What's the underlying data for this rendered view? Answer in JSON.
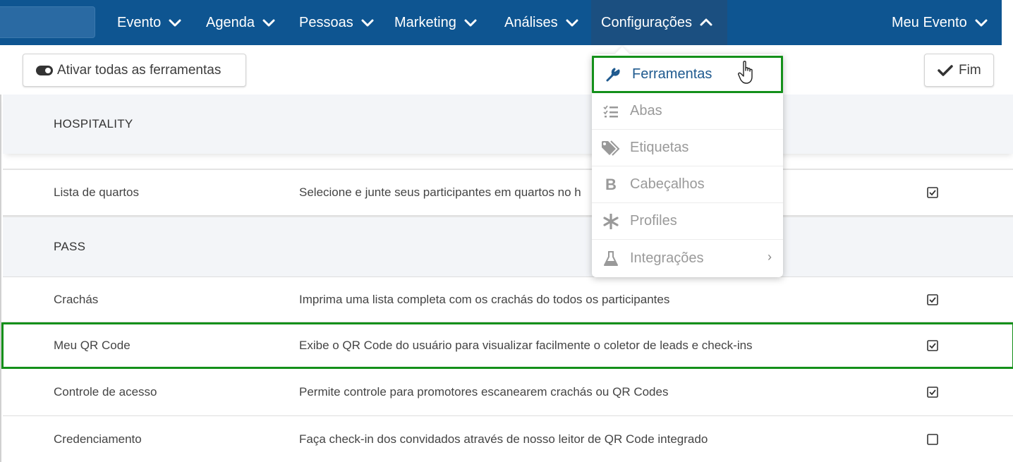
{
  "nav": {
    "items": [
      {
        "label": "Evento"
      },
      {
        "label": "Agenda"
      },
      {
        "label": "Pessoas"
      },
      {
        "label": "Marketing"
      },
      {
        "label": "Análises"
      },
      {
        "label": "Configurações"
      }
    ],
    "right": {
      "label": "Meu Evento"
    }
  },
  "toolbar": {
    "activate_label": "Ativar todas as ferramentas",
    "done_label": "Fim"
  },
  "sections": [
    {
      "title": "HOSPITALITY"
    },
    {
      "title": "PASS"
    }
  ],
  "rows": [
    {
      "name": "Lista de quartos",
      "desc": "Selecione e junte seus participantes em quartos no h",
      "checked": true
    },
    {
      "name": "Crachás",
      "desc": "Imprima uma lista completa com os crachás do todos os participantes",
      "checked": true
    },
    {
      "name": "Meu QR Code",
      "desc": "Exibe o QR Code do usuário para visualizar facilmente o coletor de leads e check-ins",
      "checked": true
    },
    {
      "name": "Controle de acesso",
      "desc": "Permite controle para promotores escanearem crachás ou QR Codes",
      "checked": true
    },
    {
      "name": "Credenciamento",
      "desc": "Faça check-in dos convidados através de nosso leitor de QR Code integrado",
      "checked": false
    }
  ],
  "dropdown": {
    "items": [
      {
        "label": "Ferramentas",
        "icon": "wrench-icon"
      },
      {
        "label": "Abas",
        "icon": "list-check-icon"
      },
      {
        "label": "Etiquetas",
        "icon": "tags-icon"
      },
      {
        "label": "Cabeçalhos",
        "icon": "bold-icon"
      },
      {
        "label": "Profiles",
        "icon": "asterisk-icon"
      },
      {
        "label": "Integrações",
        "icon": "flask-icon"
      }
    ]
  },
  "colors": {
    "nav_bg": "#0e5591",
    "highlight": "#14901a",
    "active_text": "#1f5a8f"
  }
}
